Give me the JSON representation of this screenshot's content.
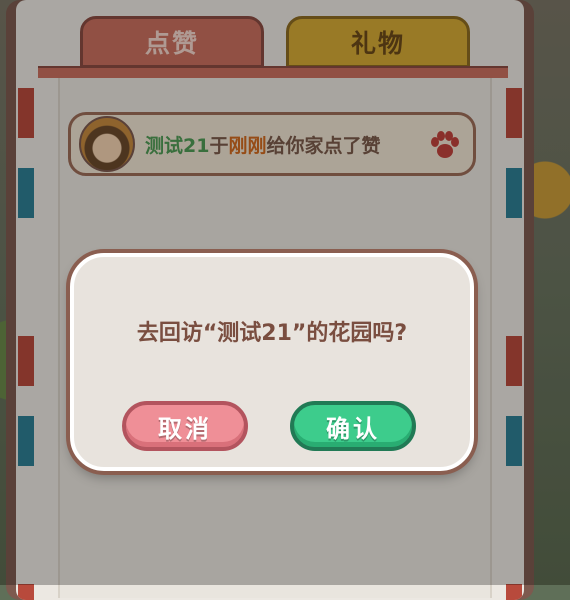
{
  "tabs": [
    {
      "label": "点赞",
      "active": true
    },
    {
      "label": "礼物",
      "active": false
    }
  ],
  "notice": {
    "name": "测试21",
    "text_1": "于",
    "time": "刚刚",
    "text_2": "给你家点了赞",
    "icon": "paw-icon"
  },
  "dialog": {
    "message": "去回访“测试21”的花园吗?",
    "cancel_label": "取消",
    "confirm_label": "确认"
  },
  "colors": {
    "like_tab": "#c9705f",
    "gift_tab": "#d4a935",
    "name_green": "#4f9a55",
    "time_orange": "#d06a1f",
    "cancel_button": "#ef8f97",
    "confirm_button": "#3dcc8c"
  }
}
